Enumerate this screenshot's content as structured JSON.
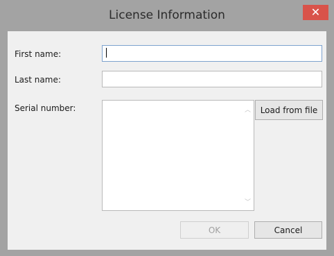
{
  "window": {
    "title": "License Information",
    "close_glyph": "✕"
  },
  "form": {
    "first_name_label": "First name:",
    "first_name_value": "",
    "last_name_label": "Last name:",
    "last_name_value": "",
    "serial_label": "Serial number:",
    "serial_value": "",
    "load_button": "Load from file",
    "scroll_up_glyph": "︿",
    "scroll_down_glyph": "﹀"
  },
  "footer": {
    "ok_label": "OK",
    "ok_enabled": false,
    "cancel_label": "Cancel"
  },
  "colors": {
    "close_button": "#d9534a",
    "focus_border": "#7da2ce"
  },
  "icons": {
    "close": "close-icon",
    "scroll_up": "chevron-up-icon",
    "scroll_down": "chevron-down-icon"
  }
}
